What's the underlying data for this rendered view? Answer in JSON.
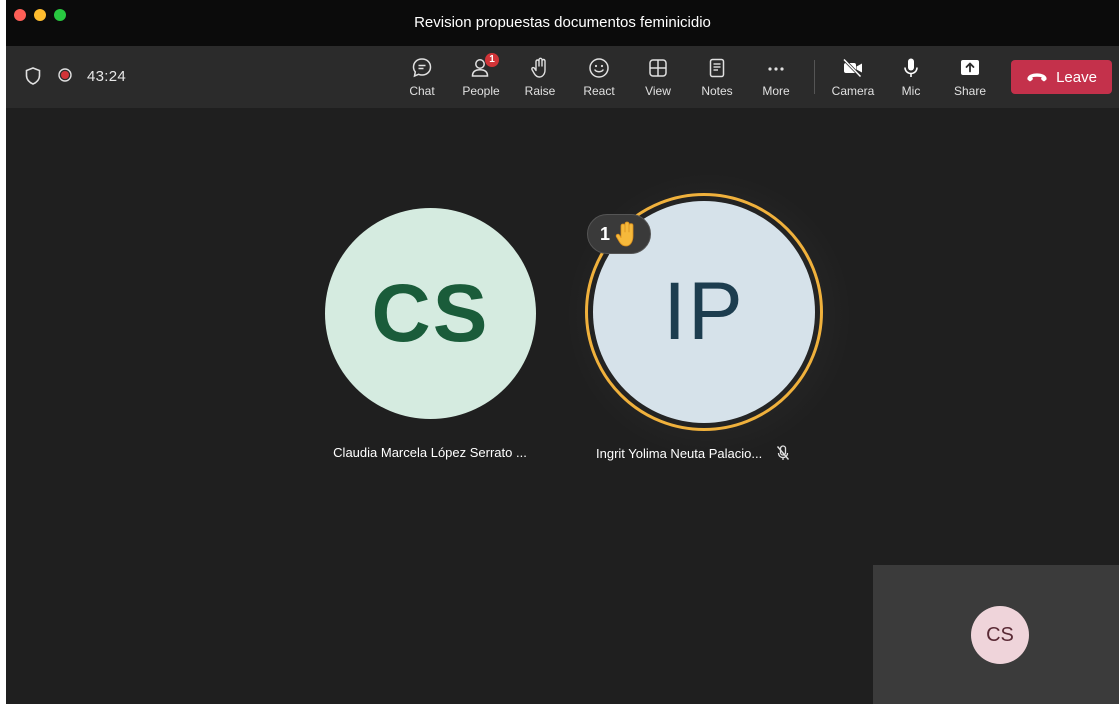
{
  "window": {
    "title": "Revision propuestas documentos feminicidio"
  },
  "toolbar": {
    "timer": "43:24",
    "buttons": [
      {
        "label": "Chat",
        "icon": "chat-icon"
      },
      {
        "label": "People",
        "icon": "people-icon",
        "badge": "1"
      },
      {
        "label": "Raise",
        "icon": "raise-hand-icon"
      },
      {
        "label": "React",
        "icon": "smiley-icon"
      },
      {
        "label": "View",
        "icon": "grid-icon"
      },
      {
        "label": "Notes",
        "icon": "notes-icon"
      },
      {
        "label": "More",
        "icon": "more-icon"
      },
      {
        "label": "Camera",
        "icon": "camera-off-icon"
      },
      {
        "label": "Mic",
        "icon": "mic-icon"
      },
      {
        "label": "Share",
        "icon": "share-icon"
      }
    ],
    "leave_label": "Leave",
    "leave_color": "#c4314b"
  },
  "participants": [
    {
      "initials": "CS",
      "name": "Claudia Marcela López Serrato ...",
      "avatar_color": "#d5ebe0"
    },
    {
      "initials": "IP",
      "name": "Ingrit Yolima Neuta Palacio...",
      "avatar_color": "#d6e2ea",
      "raised_hand_count": "1",
      "muted": true
    }
  ],
  "self_view": {
    "initials": "CS",
    "avatar_color": "#efd4da"
  },
  "colors": {
    "raise_ring": "#f0b13c",
    "recording": "#d13438"
  }
}
